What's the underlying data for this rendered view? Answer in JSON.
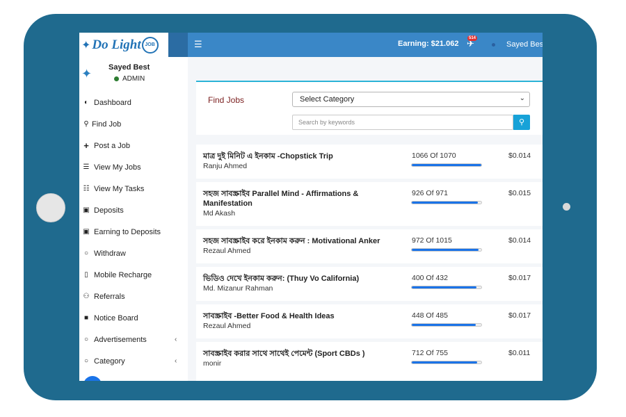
{
  "brand": {
    "name": "Do Light",
    "badge": "JOB"
  },
  "topbar": {
    "earning": "Earning: $21.062",
    "notifications": "514",
    "user": "Sayed Best"
  },
  "profile": {
    "name": "Sayed Best",
    "role": "ADMIN"
  },
  "sidebar": {
    "items": [
      {
        "label": "Dashboard",
        "icon": "dashboard-icon",
        "glyph": "◐"
      },
      {
        "label": "Find Job",
        "icon": "search-icon",
        "glyph": "⚲"
      },
      {
        "label": "Post a Job",
        "icon": "plus-icon",
        "glyph": "+"
      },
      {
        "label": "View My Jobs",
        "icon": "list-icon",
        "glyph": "☰"
      },
      {
        "label": "View My Tasks",
        "icon": "tasks-icon",
        "glyph": "☷"
      },
      {
        "label": "Deposits",
        "icon": "money-icon",
        "glyph": "▣"
      },
      {
        "label": "Earning to Deposits",
        "icon": "money-icon",
        "glyph": "▣"
      },
      {
        "label": "Withdraw",
        "icon": "circle-icon",
        "glyph": "○"
      },
      {
        "label": "Mobile Recharge",
        "icon": "mobile-icon",
        "glyph": "▯"
      },
      {
        "label": "Referrals",
        "icon": "users-icon",
        "glyph": "⚇"
      },
      {
        "label": "Notice Board",
        "icon": "file-icon",
        "glyph": "■"
      },
      {
        "label": "Advertisements",
        "icon": "circle-icon",
        "glyph": "○"
      },
      {
        "label": "Category",
        "icon": "circle-icon",
        "glyph": "○"
      }
    ]
  },
  "find_jobs": {
    "title": "Find Jobs",
    "category_select": "Select Category",
    "search_placeholder": "Search by keywords"
  },
  "jobs": [
    {
      "title": "মাত্র দুই মিনিট এ ইনকাম -Chopstick Trip",
      "author": "Ranju Ahmed",
      "progress": "1066 Of 1070",
      "done": 1066,
      "total": 1070,
      "price": "$0.014"
    },
    {
      "title": "সহজ সাবস্ক্রাইব Parallel Mind - Affirmations & Manifestation",
      "author": "Md Akash",
      "progress": "926 Of 971",
      "done": 926,
      "total": 971,
      "price": "$0.015"
    },
    {
      "title": "সহজ সাবস্ক্রাইব করে ইনকাম করুন : Motivational Anker",
      "author": "Rezaul Ahmed",
      "progress": "972 Of 1015",
      "done": 972,
      "total": 1015,
      "price": "$0.014"
    },
    {
      "title": "ভিডিও দেখে ইনকাম করুন: (Thuy Vo California)",
      "author": "Md. Mizanur Rahman",
      "progress": "400 Of 432",
      "done": 400,
      "total": 432,
      "price": "$0.017"
    },
    {
      "title": "সাবস্ক্রাইব -Better Food & Health Ideas",
      "author": "Rezaul Ahmed",
      "progress": "448 Of 485",
      "done": 448,
      "total": 485,
      "price": "$0.017"
    },
    {
      "title": "সাবস্ক্রাইব করার সাথে সাথেই পেমেন্ট (Sport CBDs )",
      "author": "monir",
      "progress": "712 Of 755",
      "done": 712,
      "total": 755,
      "price": "$0.011"
    }
  ],
  "colors": {
    "frame": "#1f6a8e",
    "topbar": "#3a87c7",
    "accent": "#1a73e8",
    "heading": "#7a1e1e"
  }
}
